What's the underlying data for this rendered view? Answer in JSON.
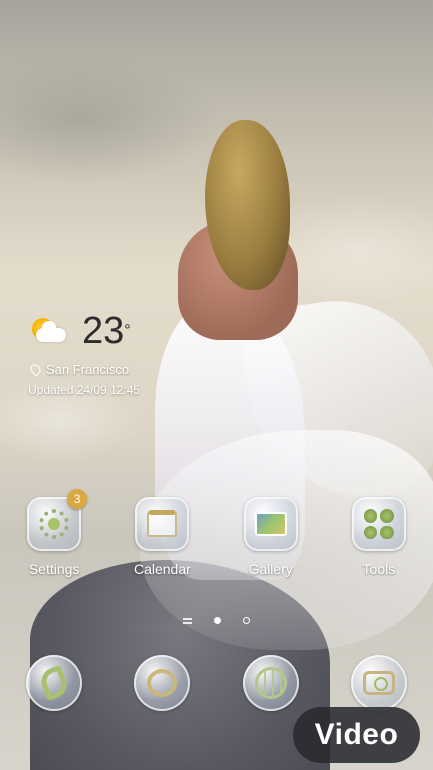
{
  "weather": {
    "temperature": "23",
    "unit": "°",
    "location": "San Francisco",
    "updated": "Updated 24/09 12:45",
    "icon": "partly-cloudy-icon"
  },
  "apps": [
    {
      "label": "Settings",
      "icon": "settings-gear-icon",
      "badge": "3"
    },
    {
      "label": "Calendar",
      "icon": "calendar-icon"
    },
    {
      "label": "Gallery",
      "icon": "gallery-icon"
    },
    {
      "label": "Tools",
      "icon": "tools-folder-icon"
    }
  ],
  "dock": [
    {
      "icon": "phone-icon"
    },
    {
      "icon": "messages-icon"
    },
    {
      "icon": "internet-globe-icon"
    },
    {
      "icon": "camera-icon"
    }
  ],
  "pager": {
    "pages": 2,
    "current": 1
  },
  "video_chip": {
    "label": "Video"
  },
  "colors": {
    "badge": "#d9a941",
    "chip_bg": "#2a2c30",
    "text": "#ffffff"
  }
}
